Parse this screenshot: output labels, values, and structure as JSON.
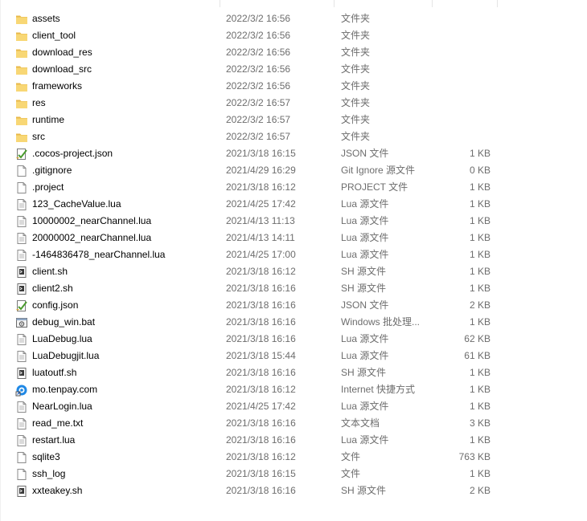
{
  "files": [
    {
      "name": "assets",
      "date": "2022/3/2 16:56",
      "type": "文件夹",
      "size": "",
      "icon": "folder-icon"
    },
    {
      "name": "client_tool",
      "date": "2022/3/2 16:56",
      "type": "文件夹",
      "size": "",
      "icon": "folder-icon"
    },
    {
      "name": "download_res",
      "date": "2022/3/2 16:56",
      "type": "文件夹",
      "size": "",
      "icon": "folder-icon"
    },
    {
      "name": "download_src",
      "date": "2022/3/2 16:56",
      "type": "文件夹",
      "size": "",
      "icon": "folder-icon"
    },
    {
      "name": "frameworks",
      "date": "2022/3/2 16:56",
      "type": "文件夹",
      "size": "",
      "icon": "folder-icon"
    },
    {
      "name": "res",
      "date": "2022/3/2 16:57",
      "type": "文件夹",
      "size": "",
      "icon": "folder-icon"
    },
    {
      "name": "runtime",
      "date": "2022/3/2 16:57",
      "type": "文件夹",
      "size": "",
      "icon": "folder-icon"
    },
    {
      "name": "src",
      "date": "2022/3/2 16:57",
      "type": "文件夹",
      "size": "",
      "icon": "folder-icon"
    },
    {
      "name": ".cocos-project.json",
      "date": "2021/3/18 16:15",
      "type": "JSON 文件",
      "size": "1 KB",
      "icon": "json-file-icon"
    },
    {
      "name": ".gitignore",
      "date": "2021/4/29 16:29",
      "type": "Git Ignore 源文件",
      "size": "0 KB",
      "icon": "file-icon"
    },
    {
      "name": ".project",
      "date": "2021/3/18 16:12",
      "type": "PROJECT 文件",
      "size": "1 KB",
      "icon": "file-icon"
    },
    {
      "name": "123_CacheValue.lua",
      "date": "2021/4/25 17:42",
      "type": "Lua 源文件",
      "size": "1 KB",
      "icon": "text-file-icon"
    },
    {
      "name": "10000002_nearChannel.lua",
      "date": "2021/4/13 11:13",
      "type": "Lua 源文件",
      "size": "1 KB",
      "icon": "text-file-icon"
    },
    {
      "name": "20000002_nearChannel.lua",
      "date": "2021/4/13 14:11",
      "type": "Lua 源文件",
      "size": "1 KB",
      "icon": "text-file-icon"
    },
    {
      "name": "-1464836478_nearChannel.lua",
      "date": "2021/4/25 17:00",
      "type": "Lua 源文件",
      "size": "1 KB",
      "icon": "text-file-icon"
    },
    {
      "name": "client.sh",
      "date": "2021/3/18 16:12",
      "type": "SH 源文件",
      "size": "1 KB",
      "icon": "shell-file-icon"
    },
    {
      "name": "client2.sh",
      "date": "2021/3/18 16:16",
      "type": "SH 源文件",
      "size": "1 KB",
      "icon": "shell-file-icon"
    },
    {
      "name": "config.json",
      "date": "2021/3/18 16:16",
      "type": "JSON 文件",
      "size": "2 KB",
      "icon": "json-file-icon"
    },
    {
      "name": "debug_win.bat",
      "date": "2021/3/18 16:16",
      "type": "Windows 批处理...",
      "size": "1 KB",
      "icon": "batch-file-icon"
    },
    {
      "name": "LuaDebug.lua",
      "date": "2021/3/18 16:16",
      "type": "Lua 源文件",
      "size": "62 KB",
      "icon": "text-file-icon"
    },
    {
      "name": "LuaDebugjit.lua",
      "date": "2021/3/18 15:44",
      "type": "Lua 源文件",
      "size": "61 KB",
      "icon": "text-file-icon"
    },
    {
      "name": "luatoutf.sh",
      "date": "2021/3/18 16:16",
      "type": "SH 源文件",
      "size": "1 KB",
      "icon": "shell-file-icon"
    },
    {
      "name": "mo.tenpay.com",
      "date": "2021/3/18 16:12",
      "type": "Internet 快捷方式",
      "size": "1 KB",
      "icon": "internet-shortcut-icon"
    },
    {
      "name": "NearLogin.lua",
      "date": "2021/4/25 17:42",
      "type": "Lua 源文件",
      "size": "1 KB",
      "icon": "text-file-icon"
    },
    {
      "name": "read_me.txt",
      "date": "2021/3/18 16:16",
      "type": "文本文档",
      "size": "3 KB",
      "icon": "text-file-icon"
    },
    {
      "name": "restart.lua",
      "date": "2021/3/18 16:16",
      "type": "Lua 源文件",
      "size": "1 KB",
      "icon": "text-file-icon"
    },
    {
      "name": "sqlite3",
      "date": "2021/3/18 16:12",
      "type": "文件",
      "size": "763 KB",
      "icon": "file-icon"
    },
    {
      "name": "ssh_log",
      "date": "2021/3/18 16:15",
      "type": "文件",
      "size": "1 KB",
      "icon": "file-icon"
    },
    {
      "name": "xxteakey.sh",
      "date": "2021/3/18 16:16",
      "type": "SH 源文件",
      "size": "2 KB",
      "icon": "shell-file-icon"
    }
  ]
}
